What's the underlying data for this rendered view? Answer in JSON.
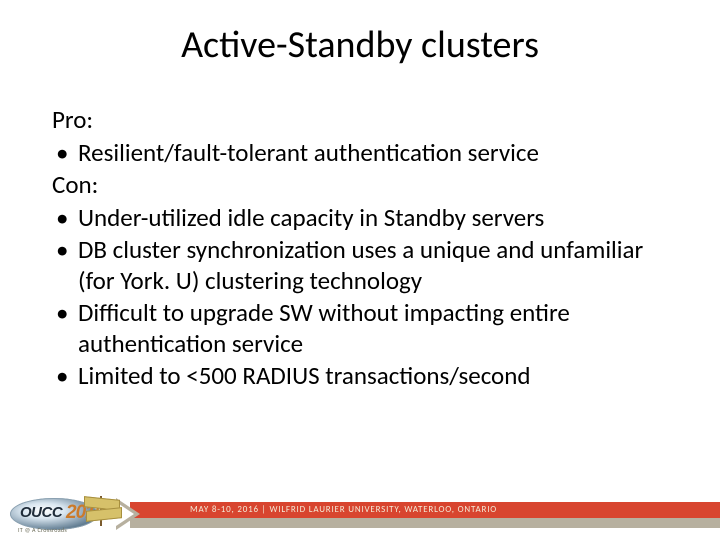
{
  "title": "Active-Standby clusters",
  "pro_label": "Pro:",
  "pros": [
    "Resilient/fault-tolerant authentication service"
  ],
  "con_label": "Con:",
  "cons": [
    "Under-utilized idle capacity in Standby servers",
    "DB cluster synchronization uses a unique and unfamiliar (for York. U) clustering technology",
    "Difficult to upgrade SW without impacting entire authentication service",
    "Limited to <500 RADIUS transactions/second"
  ],
  "footer": {
    "date_venue": "MAY 8-10, 2016  |  WILFRID LAURIER UNIVERSITY, WATERLOO, ONTARIO",
    "logo_main": "OUCC",
    "logo_year": "2016",
    "logo_sub": "IT @ A Crossroads"
  }
}
